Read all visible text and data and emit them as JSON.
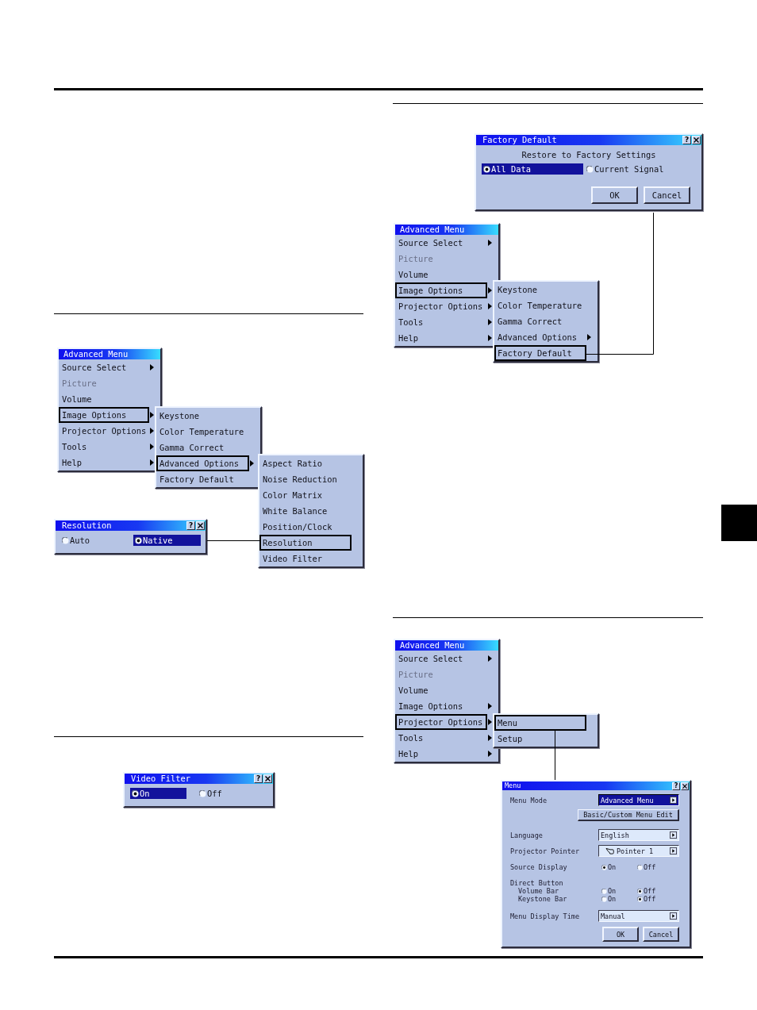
{
  "left_column": {
    "figure_1": {
      "advanced_menu": {
        "title": "Advanced Menu",
        "items": [
          {
            "label": "Source Select",
            "submenu": true,
            "selected": false,
            "disabled": false
          },
          {
            "label": "Picture",
            "submenu": false,
            "selected": false,
            "disabled": true
          },
          {
            "label": "Volume",
            "submenu": false,
            "selected": false,
            "disabled": false
          },
          {
            "label": "Image Options",
            "submenu": true,
            "selected": true,
            "disabled": false
          },
          {
            "label": "Projector Options",
            "submenu": true,
            "selected": false,
            "disabled": false
          },
          {
            "label": "Tools",
            "submenu": true,
            "selected": false,
            "disabled": false
          },
          {
            "label": "Help",
            "submenu": true,
            "selected": false,
            "disabled": false
          }
        ]
      },
      "image_options_menu": {
        "items": [
          {
            "label": "Keystone",
            "submenu": false,
            "selected": false,
            "disabled": false
          },
          {
            "label": "Color Temperature",
            "submenu": false,
            "selected": false,
            "disabled": false
          },
          {
            "label": "Gamma Correct",
            "submenu": false,
            "selected": false,
            "disabled": false
          },
          {
            "label": "Advanced Options",
            "submenu": true,
            "selected": true,
            "disabled": false
          },
          {
            "label": "Factory Default",
            "submenu": false,
            "selected": false,
            "disabled": false
          }
        ]
      },
      "advanced_options_menu": {
        "items": [
          {
            "label": "Aspect Ratio",
            "submenu": false,
            "selected": false,
            "disabled": false
          },
          {
            "label": "Noise Reduction",
            "submenu": false,
            "selected": false,
            "disabled": false
          },
          {
            "label": "Color Matrix",
            "submenu": false,
            "selected": false,
            "disabled": false
          },
          {
            "label": "White Balance",
            "submenu": false,
            "selected": false,
            "disabled": false
          },
          {
            "label": "Position/Clock",
            "submenu": false,
            "selected": false,
            "disabled": false
          },
          {
            "label": "Resolution",
            "submenu": false,
            "selected": true,
            "disabled": false
          },
          {
            "label": "Video Filter",
            "submenu": false,
            "selected": false,
            "disabled": false
          }
        ]
      },
      "resolution_dialog": {
        "title": "Resolution",
        "help": "?",
        "options": [
          {
            "label": "Auto",
            "selected": false
          },
          {
            "label": "Native",
            "selected": true
          }
        ]
      }
    },
    "figure_2": {
      "video_filter_dialog": {
        "title": "Video Filter",
        "help": "?",
        "options": [
          {
            "label": "On",
            "selected": true
          },
          {
            "label": "Off",
            "selected": false
          }
        ]
      }
    }
  },
  "right_column": {
    "figure_1": {
      "factory_default_dialog": {
        "title": "Factory Default",
        "help": "?",
        "prompt": "Restore to Factory Settings",
        "options": [
          {
            "label": "All Data",
            "selected": true
          },
          {
            "label": "Current Signal",
            "selected": false
          }
        ],
        "buttons": [
          "OK",
          "Cancel"
        ]
      },
      "advanced_menu": {
        "title": "Advanced Menu",
        "items": [
          {
            "label": "Source Select",
            "submenu": true,
            "selected": false,
            "disabled": false
          },
          {
            "label": "Picture",
            "submenu": false,
            "selected": false,
            "disabled": true
          },
          {
            "label": "Volume",
            "submenu": false,
            "selected": false,
            "disabled": false
          },
          {
            "label": "Image Options",
            "submenu": true,
            "selected": true,
            "disabled": false
          },
          {
            "label": "Projector Options",
            "submenu": true,
            "selected": false,
            "disabled": false
          },
          {
            "label": "Tools",
            "submenu": true,
            "selected": false,
            "disabled": false
          },
          {
            "label": "Help",
            "submenu": true,
            "selected": false,
            "disabled": false
          }
        ]
      },
      "image_options_menu": {
        "items": [
          {
            "label": "Keystone",
            "submenu": false,
            "selected": false,
            "disabled": false
          },
          {
            "label": "Color Temperature",
            "submenu": false,
            "selected": false,
            "disabled": false
          },
          {
            "label": "Gamma Correct",
            "submenu": false,
            "selected": false,
            "disabled": false
          },
          {
            "label": "Advanced Options",
            "submenu": true,
            "selected": false,
            "disabled": false
          },
          {
            "label": "Factory Default",
            "submenu": false,
            "selected": true,
            "disabled": false
          }
        ]
      }
    },
    "figure_2": {
      "advanced_menu": {
        "title": "Advanced Menu",
        "items": [
          {
            "label": "Source Select",
            "submenu": true,
            "selected": false,
            "disabled": false
          },
          {
            "label": "Picture",
            "submenu": false,
            "selected": false,
            "disabled": true
          },
          {
            "label": "Volume",
            "submenu": false,
            "selected": false,
            "disabled": false
          },
          {
            "label": "Image Options",
            "submenu": true,
            "selected": false,
            "disabled": false
          },
          {
            "label": "Projector Options",
            "submenu": true,
            "selected": true,
            "disabled": false
          },
          {
            "label": "Tools",
            "submenu": true,
            "selected": false,
            "disabled": false
          },
          {
            "label": "Help",
            "submenu": true,
            "selected": false,
            "disabled": false
          }
        ]
      },
      "projector_options_menu": {
        "items": [
          {
            "label": "Menu",
            "submenu": false,
            "selected": true,
            "disabled": false
          },
          {
            "label": "Setup",
            "submenu": false,
            "selected": false,
            "disabled": false
          }
        ]
      },
      "menu_dialog": {
        "title": "Menu",
        "help": "?",
        "rows": [
          {
            "kind": "dropdown",
            "label": "Menu Mode",
            "value": "Advanced Menu",
            "focused": true,
            "pointer_icon": false
          },
          {
            "kind": "button",
            "label": "Basic/Custom Menu Edit"
          },
          {
            "kind": "dropdown",
            "label": "Language",
            "value": "English",
            "focused": false,
            "pointer_icon": false
          },
          {
            "kind": "dropdown",
            "label": "Projector Pointer",
            "value": "Pointer 1",
            "focused": false,
            "pointer_icon": true
          },
          {
            "kind": "radio",
            "label": "Source Display",
            "options": [
              {
                "label": "On",
                "selected": true
              },
              {
                "label": "Off",
                "selected": false
              }
            ]
          },
          {
            "kind": "group",
            "label": "Direct Button",
            "children": [
              {
                "kind": "radio",
                "label": "Volume Bar",
                "options": [
                  {
                    "label": "On",
                    "selected": false
                  },
                  {
                    "label": "Off",
                    "selected": true
                  }
                ]
              },
              {
                "kind": "radio",
                "label": "Keystone Bar",
                "options": [
                  {
                    "label": "On",
                    "selected": false
                  },
                  {
                    "label": "Off",
                    "selected": true
                  }
                ]
              }
            ]
          },
          {
            "kind": "dropdown",
            "label": "Menu Display Time",
            "value": "Manual",
            "focused": false,
            "pointer_icon": false
          }
        ],
        "buttons": [
          "OK",
          "Cancel"
        ]
      }
    }
  }
}
